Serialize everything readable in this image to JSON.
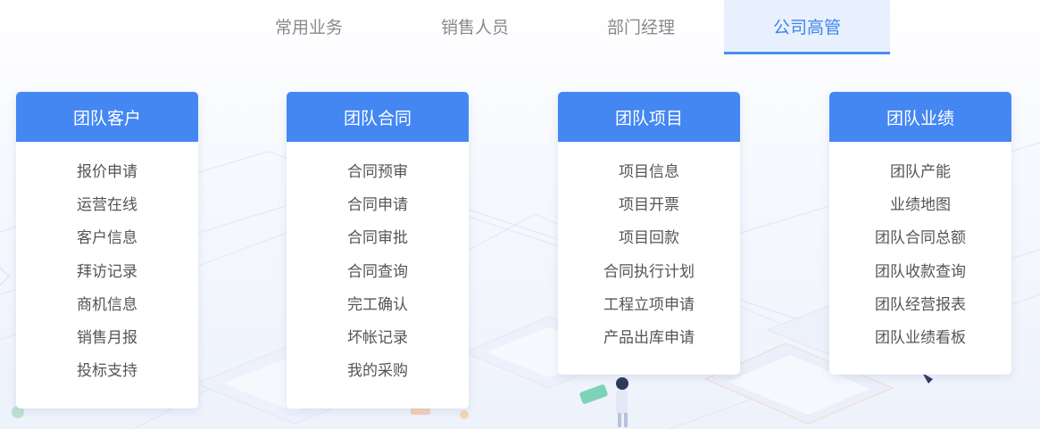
{
  "tabs": [
    {
      "label": "常用业务"
    },
    {
      "label": "销售人员"
    },
    {
      "label": "部门经理"
    },
    {
      "label": "公司高管",
      "active": true
    }
  ],
  "cards": [
    {
      "title": "团队客户",
      "items": [
        "报价申请",
        "运营在线",
        "客户信息",
        "拜访记录",
        "商机信息",
        "销售月报",
        "投标支持"
      ]
    },
    {
      "title": "团队合同",
      "items": [
        "合同预审",
        "合同申请",
        "合同审批",
        "合同查询",
        "完工确认",
        "坏帐记录",
        "我的采购"
      ]
    },
    {
      "title": "团队项目",
      "items": [
        "项目信息",
        "项目开票",
        "项目回款",
        "合同执行计划",
        "工程立项申请",
        "产品出库申请"
      ]
    },
    {
      "title": "团队业绩",
      "items": [
        "团队产能",
        "业绩地图",
        "团队合同总额",
        "团队收款查询",
        "团队经营报表",
        "团队业绩看板"
      ]
    }
  ],
  "colors": {
    "accent": "#4487f2",
    "tab_active_bg": "#e8f0fd",
    "tab_active_text": "#3e84ee",
    "item_text": "#555555"
  }
}
